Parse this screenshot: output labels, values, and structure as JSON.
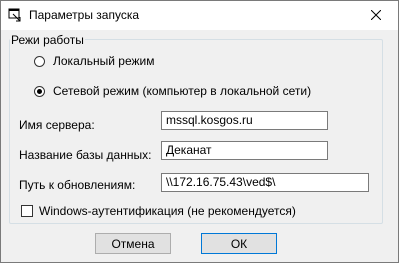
{
  "window": {
    "title": "Параметры запуска",
    "close_glyph": "✕"
  },
  "mode_group": {
    "legend": "Режи работы",
    "options": [
      {
        "label": "Локальный режим",
        "checked": false
      },
      {
        "label": "Сетевой режим (компьютер в локальной  сети)",
        "checked": true
      }
    ]
  },
  "fields": {
    "server_label": "Имя сервера:",
    "server_value": "mssql.kosgos.ru",
    "db_label": "Название базы данных:",
    "db_value": "Деканат",
    "update_label": "Путь к обновлениям:",
    "update_value": "\\\\172.16.75.43\\ved$\\"
  },
  "windows_auth": {
    "label": "Windows-аутентификация (не рекомендуется)",
    "checked": false
  },
  "buttons": {
    "cancel": "Отмена",
    "ok": "ОК"
  },
  "icons": {
    "app": "app-window-icon",
    "close": "close-icon"
  }
}
